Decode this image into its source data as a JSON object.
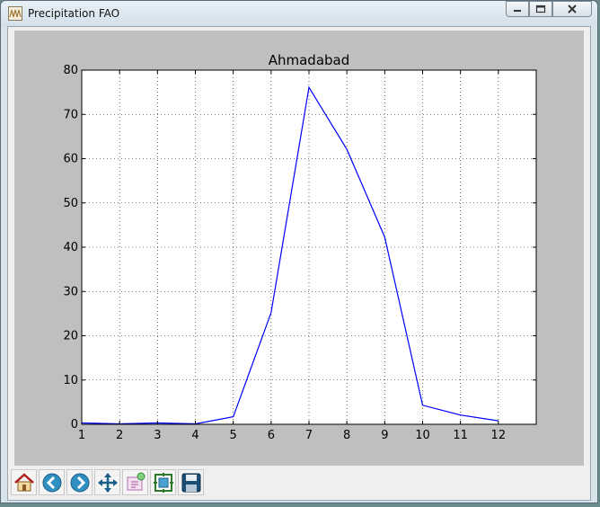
{
  "window": {
    "title": "Precipitation FAO",
    "icon": "chart-app-icon"
  },
  "caption_buttons": [
    {
      "name": "minimize-button",
      "icon": "minimize-icon"
    },
    {
      "name": "maximize-button",
      "icon": "maximize-icon"
    },
    {
      "name": "close-button",
      "icon": "close-icon"
    }
  ],
  "toolbar": [
    {
      "name": "home-button",
      "icon": "home-icon"
    },
    {
      "name": "back-button",
      "icon": "back-arrow-icon"
    },
    {
      "name": "forward-button",
      "icon": "forward-arrow-icon"
    },
    {
      "name": "pan-button",
      "icon": "pan-arrows-icon"
    },
    {
      "name": "zoom-button",
      "icon": "zoom-rect-icon"
    },
    {
      "name": "subplots-button",
      "icon": "subplots-config-icon"
    },
    {
      "name": "save-button",
      "icon": "floppy-disk-icon"
    }
  ],
  "chart_data": {
    "type": "line",
    "title": "Ahmadabad",
    "xlabel": "",
    "ylabel": "",
    "x": [
      1,
      2,
      3,
      4,
      5,
      6,
      7,
      8,
      9,
      10,
      11,
      12
    ],
    "series": [
      {
        "values": [
          0.3,
          0.1,
          0.3,
          0.1,
          1.7,
          25.2,
          76.1,
          62.1,
          42.3,
          4.3,
          2.1,
          0.8
        ]
      }
    ],
    "xlim": [
      1,
      13
    ],
    "ylim": [
      0,
      80
    ],
    "xticks": [
      1,
      2,
      3,
      4,
      5,
      6,
      7,
      8,
      9,
      10,
      11,
      12
    ],
    "yticks": [
      0,
      10,
      20,
      30,
      40,
      50,
      60,
      70,
      80
    ],
    "grid": true,
    "line_color": "#0000ff",
    "background": "#bfbfbf"
  }
}
